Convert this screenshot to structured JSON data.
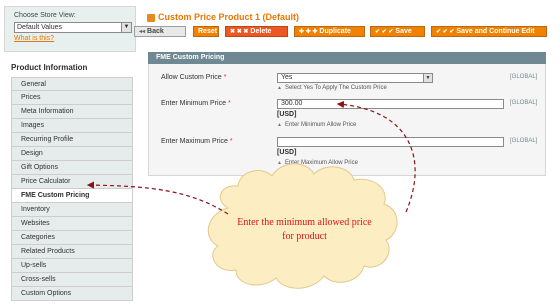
{
  "store_switcher": {
    "label": "Choose Store View:",
    "selected": "Default Values",
    "help_link": "What is this?"
  },
  "sidebar": {
    "title": "Product Information",
    "items": [
      {
        "label": "General"
      },
      {
        "label": "Prices"
      },
      {
        "label": "Meta Information"
      },
      {
        "label": "Images"
      },
      {
        "label": "Recurring Profile"
      },
      {
        "label": "Design"
      },
      {
        "label": "Gift Options"
      },
      {
        "label": "Price Calculator"
      },
      {
        "label": "FME Custom Pricing"
      },
      {
        "label": "Inventory"
      },
      {
        "label": "Websites"
      },
      {
        "label": "Categories"
      },
      {
        "label": "Related Products"
      },
      {
        "label": "Up-sells"
      },
      {
        "label": "Cross-sells"
      },
      {
        "label": "Custom Options"
      }
    ],
    "active_item": "FME Custom Pricing"
  },
  "header": {
    "title": "Custom Price Product 1 (Default)",
    "buttons": {
      "back": "Back",
      "reset": "Reset",
      "delete": "Delete",
      "duplicate": "Duplicate",
      "save": "Save",
      "save_continue": "Save and Continue Edit"
    }
  },
  "section": {
    "title": "FME Custom Pricing",
    "fields": {
      "allow": {
        "label": "Allow Custom Price",
        "required": "*",
        "value": "Yes",
        "note": "Select Yes To Apply The Custom Price",
        "scope": "[GLOBAL]"
      },
      "min_price": {
        "label": "Enter Minimum Price",
        "required": "*",
        "value": "300.00",
        "currency": "[USD]",
        "note": "Enter Minimum Allow Price",
        "scope": "[GLOBAL]"
      },
      "max_price": {
        "label": "Enter Maximum Price",
        "required": "*",
        "value": "",
        "currency": "[USD]",
        "note": "Enter Maximum Allow Price",
        "scope": "[GLOBAL]"
      }
    }
  },
  "callout": {
    "text": "Enter the minimum allowed price for product",
    "color": "#d8141e",
    "fill": "#fdedc2"
  },
  "colors": {
    "accent": "#ea7601",
    "button": "#f18200",
    "section_header": "#6f8992"
  }
}
